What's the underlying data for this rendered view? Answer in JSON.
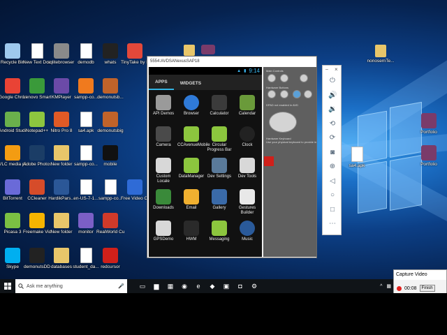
{
  "desktop": {
    "icons": [
      {
        "label": "Recycle Bin",
        "icon": "recycle-bin-icon",
        "color": "#9ec9ee"
      },
      {
        "label": "New Text Document",
        "icon": "text-document-icon",
        "color": "#ffffff"
      },
      {
        "label": "sqlitebrowser - Shortcut",
        "icon": "database-icon",
        "color": "#8a8a8a"
      },
      {
        "label": "demodb",
        "icon": "file-icon",
        "color": "#ffffff"
      },
      {
        "label": "whats",
        "icon": "whatsapp-icon",
        "color": "#222222"
      },
      {
        "label": "TinyTake by MangoApps",
        "icon": "tinytake-icon",
        "color": "#e2483a"
      },
      {
        "label": "Google Chrome",
        "icon": "chrome-icon",
        "color": "#e94335"
      },
      {
        "label": "Lenovo Smart...",
        "icon": "lenovo-icon",
        "color": "#3a9a3a"
      },
      {
        "label": "KMPlayer",
        "icon": "kmplayer-icon",
        "color": "#6b4aa8"
      },
      {
        "label": "sampp-co...",
        "icon": "xampp-icon",
        "color": "#f07a1e"
      },
      {
        "label": "demonutsb...",
        "icon": "demonuts-icon",
        "color": "#c0632a"
      },
      {
        "label": "Android Studio",
        "icon": "android-studio-icon",
        "color": "#6ab04c"
      },
      {
        "label": "Notepad++",
        "icon": "notepadpp-icon",
        "color": "#8dc63f"
      },
      {
        "label": "Nitro Pro 8",
        "icon": "nitro-icon",
        "color": "#e05a26"
      },
      {
        "label": "sa4.apk",
        "icon": "apk-file-icon",
        "color": "#ffffff"
      },
      {
        "label": "demonutsbig",
        "icon": "demonuts-icon",
        "color": "#c0632a"
      },
      {
        "label": "VLC media player",
        "icon": "vlc-icon",
        "color": "#f39c12"
      },
      {
        "label": "Adobe Photosh...",
        "icon": "photoshop-icon",
        "color": "#1b3d66"
      },
      {
        "label": "New folder",
        "icon": "folder-icon",
        "color": "#e8c66a"
      },
      {
        "label": "sampp-co...",
        "icon": "file-icon",
        "color": "#ffffff"
      },
      {
        "label": "mobile",
        "icon": "mobile-icon",
        "color": "#111111"
      },
      {
        "label": "BitTorrent",
        "icon": "bittorrent-icon",
        "color": "#6a6ad8"
      },
      {
        "label": "CCleaner",
        "icon": "ccleaner-icon",
        "color": "#d64c2a"
      },
      {
        "label": "HardikPars...",
        "icon": "word-doc-icon",
        "color": "#2b5797"
      },
      {
        "label": "en-US-7-1...",
        "icon": "file-icon",
        "color": "#ffffff"
      },
      {
        "label": "sampp-co...",
        "icon": "file-icon",
        "color": "#ffffff"
      },
      {
        "label": "Free Video Compressor",
        "icon": "video-compressor-icon",
        "color": "#2f6bd6"
      },
      {
        "label": "Picasa 3",
        "icon": "picasa-icon",
        "color": "#7bc043"
      },
      {
        "label": "Freemake Video C...",
        "icon": "freemake-icon",
        "color": "#f5b400"
      },
      {
        "label": "New folder",
        "icon": "folder-icon",
        "color": "#e8c66a"
      },
      {
        "label": "monitor",
        "icon": "monitor-icon",
        "color": "#7b5fc6"
      },
      {
        "label": "RealWorld Cursor Editor",
        "icon": "cursor-editor-icon",
        "color": "#d03a2a"
      },
      {
        "label": "Skype",
        "icon": "skype-icon",
        "color": "#00aff0"
      },
      {
        "label": "demonutsDD",
        "icon": "demonuts-icon",
        "color": "#222222"
      },
      {
        "label": "databases",
        "icon": "folder-icon",
        "color": "#e8c66a"
      },
      {
        "label": "student_da...",
        "icon": "file-icon",
        "color": "#ffffff"
      },
      {
        "label": "redcursor",
        "icon": "redcursor-icon",
        "color": "#d0201a"
      }
    ],
    "top_folder_icon": {
      "label": "",
      "icon": "folder-icon",
      "color": "#e8c66a"
    },
    "top_flag_icon": {
      "label": "",
      "icon": "winrar-icon",
      "color": "#7a3b6a"
    },
    "right_icons": [
      {
        "label": "nonosemTe...",
        "icon": "folder-icon",
        "color": "#e8c66a"
      },
      {
        "label": "Portfolio",
        "icon": "winrar-icon",
        "color": "#7a3b6a"
      },
      {
        "label": "Portfolio",
        "icon": "winrar-icon",
        "color": "#7a3b6a"
      }
    ],
    "mid_file_label": "sa4.apk"
  },
  "emulator": {
    "title": "5554:AVD_for_Nexus_4_by_Google",
    "title_display": "5554:AVDSANexusSAP18",
    "time": "9:14",
    "tabs": [
      "APPS",
      "WIDGETS"
    ],
    "apps": [
      {
        "label": "API Demos",
        "icon": "folder-settings-icon",
        "color": "#9a9a9a"
      },
      {
        "label": "Browser",
        "icon": "globe-icon",
        "color": "#2f7ad8"
      },
      {
        "label": "Calculator",
        "icon": "calculator-icon",
        "color": "#3b3b3b"
      },
      {
        "label": "Calendar",
        "icon": "calendar-icon",
        "color": "#6a9a3a"
      },
      {
        "label": "Camera",
        "icon": "camera-icon",
        "color": "#4a4a4a"
      },
      {
        "label": "CCAvenueMobile",
        "icon": "android-icon",
        "color": "#8cc63e"
      },
      {
        "label": "Circular Progress Bar",
        "icon": "android-icon",
        "color": "#8cc63e"
      },
      {
        "label": "Clock",
        "icon": "clock-icon",
        "color": "#222222"
      },
      {
        "label": "Custom Locale",
        "icon": "gear-icon",
        "color": "#d8d8d8"
      },
      {
        "label": "DataManager",
        "icon": "android-icon",
        "color": "#8cc63e"
      },
      {
        "label": "Dev Settings",
        "icon": "dev-settings-icon",
        "color": "#5a7a9a"
      },
      {
        "label": "Dev Tools",
        "icon": "gear-icon",
        "color": "#d8d8d8"
      },
      {
        "label": "Downloads",
        "icon": "download-icon",
        "color": "#3a8a3a"
      },
      {
        "label": "Email",
        "icon": "email-icon",
        "color": "#f0b030"
      },
      {
        "label": "Gallery",
        "icon": "gallery-icon",
        "color": "#3a6aa8"
      },
      {
        "label": "Gestures Builder",
        "icon": "gestures-icon",
        "color": "#e8e8e8"
      },
      {
        "label": "GPSDemo",
        "icon": "gear-icon",
        "color": "#d8d8d8"
      },
      {
        "label": "HWM",
        "icon": "hwm-icon",
        "color": "#2a2a2a"
      },
      {
        "label": "Messaging",
        "icon": "messaging-icon",
        "color": "#8cc63e"
      },
      {
        "label": "Music",
        "icon": "music-icon",
        "color": "#2a5a9a"
      }
    ],
    "controls": {
      "main_controls_label": "Main Controls",
      "hardware_buttons_label": "Hardware Buttons",
      "dpad_label": "DPAD not enabled in AVD",
      "keyboard_label": "Hardware Keyboard",
      "keyboard_hint": "Use your physical keyboard to provide input"
    }
  },
  "sidebar": {
    "buttons": [
      {
        "icon": "power-icon",
        "glyph": "⏻"
      },
      {
        "icon": "volume-up-icon",
        "glyph": "🔊"
      },
      {
        "icon": "volume-down-icon",
        "glyph": "🔉"
      },
      {
        "icon": "rotate-left-icon",
        "glyph": "⟲"
      },
      {
        "icon": "rotate-right-icon",
        "glyph": "⟳"
      },
      {
        "icon": "camera-icon",
        "glyph": "◙"
      },
      {
        "icon": "zoom-icon",
        "glyph": "⊕"
      },
      {
        "icon": "back-icon",
        "glyph": "◁"
      },
      {
        "icon": "home-icon",
        "glyph": "○"
      },
      {
        "icon": "overview-icon",
        "glyph": "□"
      },
      {
        "icon": "more-icon",
        "glyph": "⋯"
      }
    ],
    "minimize": "–",
    "close": "×"
  },
  "taskbar": {
    "search_placeholder": "Ask me anything",
    "apps": [
      {
        "icon": "task-view-icon",
        "glyph": "▭"
      },
      {
        "icon": "file-explorer-icon",
        "glyph": "▆"
      },
      {
        "icon": "store-icon",
        "glyph": "▦"
      },
      {
        "icon": "chrome-icon",
        "glyph": "◉"
      },
      {
        "icon": "edge-icon",
        "glyph": "e"
      },
      {
        "icon": "android-studio-icon",
        "glyph": "◆"
      },
      {
        "icon": "emulator-icon",
        "glyph": "▣"
      },
      {
        "icon": "tinytake-icon",
        "glyph": "◘"
      },
      {
        "icon": "settings-icon",
        "glyph": "⚙"
      }
    ]
  },
  "capture": {
    "title": "Capture Video",
    "timer": "00:08",
    "finish_label": "Finish"
  }
}
